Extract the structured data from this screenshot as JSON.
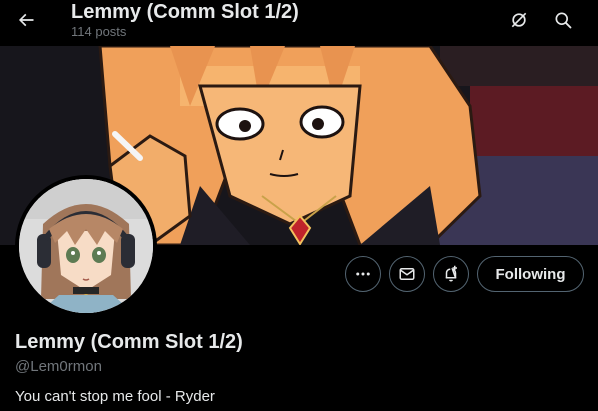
{
  "header": {
    "name": "Lemmy (Comm Slot 1/2)",
    "posts_count": "114 posts",
    "back_icon": "arrow-left-icon",
    "mute_icon": "mute-icon",
    "search_icon": "search-icon"
  },
  "profile": {
    "name": "Lemmy (Comm Slot 1/2)",
    "handle": "@Lem0rmon",
    "bio": "You can't stop me fool - Ryder"
  },
  "actions": {
    "more_icon": "more-icon",
    "message_icon": "envelope-icon",
    "notify_icon": "bell-plus-icon",
    "following_label": "Following"
  },
  "colors": {
    "background": "#000000",
    "primary_text": "#e7e9ea",
    "secondary_text": "#71767b",
    "button_border": "#536471",
    "banner_orange": "#f2a25a"
  }
}
